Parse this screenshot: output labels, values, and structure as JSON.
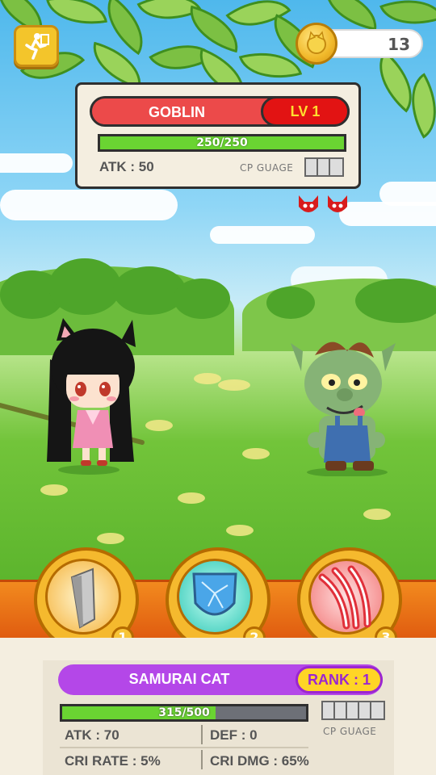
{
  "hud": {
    "coin_count": "13"
  },
  "enemy": {
    "name": "GOBLIN",
    "level": "LV 1",
    "hp_text": "250/250",
    "hp_fraction": 1.0,
    "atk": "ATK : 50",
    "cp_label": "CP GUAGE",
    "cp_slots": 3
  },
  "skills": [
    {
      "number": "1",
      "icon": "sword-icon"
    },
    {
      "number": "2",
      "icon": "shield-icon"
    },
    {
      "number": "3",
      "icon": "claw-slash-icon"
    }
  ],
  "player": {
    "name": "SAMURAI CAT",
    "rank": "RANK : 1",
    "hp_text": "315/500",
    "hp_fraction": 0.63,
    "atk": "ATK : 70",
    "def": "DEF : 0",
    "cri_rate": "CRI RATE : 5%",
    "cri_dmg": "CRI DMG : 65%",
    "cp_label": "CP GUAGE",
    "cp_slots": 5
  },
  "colors": {
    "enemy_name_bar": "#ec4a4a",
    "enemy_level_badge": "#e21313",
    "player_name_bar": "#b447e8",
    "player_rank_badge": "#ffd526",
    "hp_fill": "#6ad432",
    "skill_strip": "#f28a1e"
  }
}
